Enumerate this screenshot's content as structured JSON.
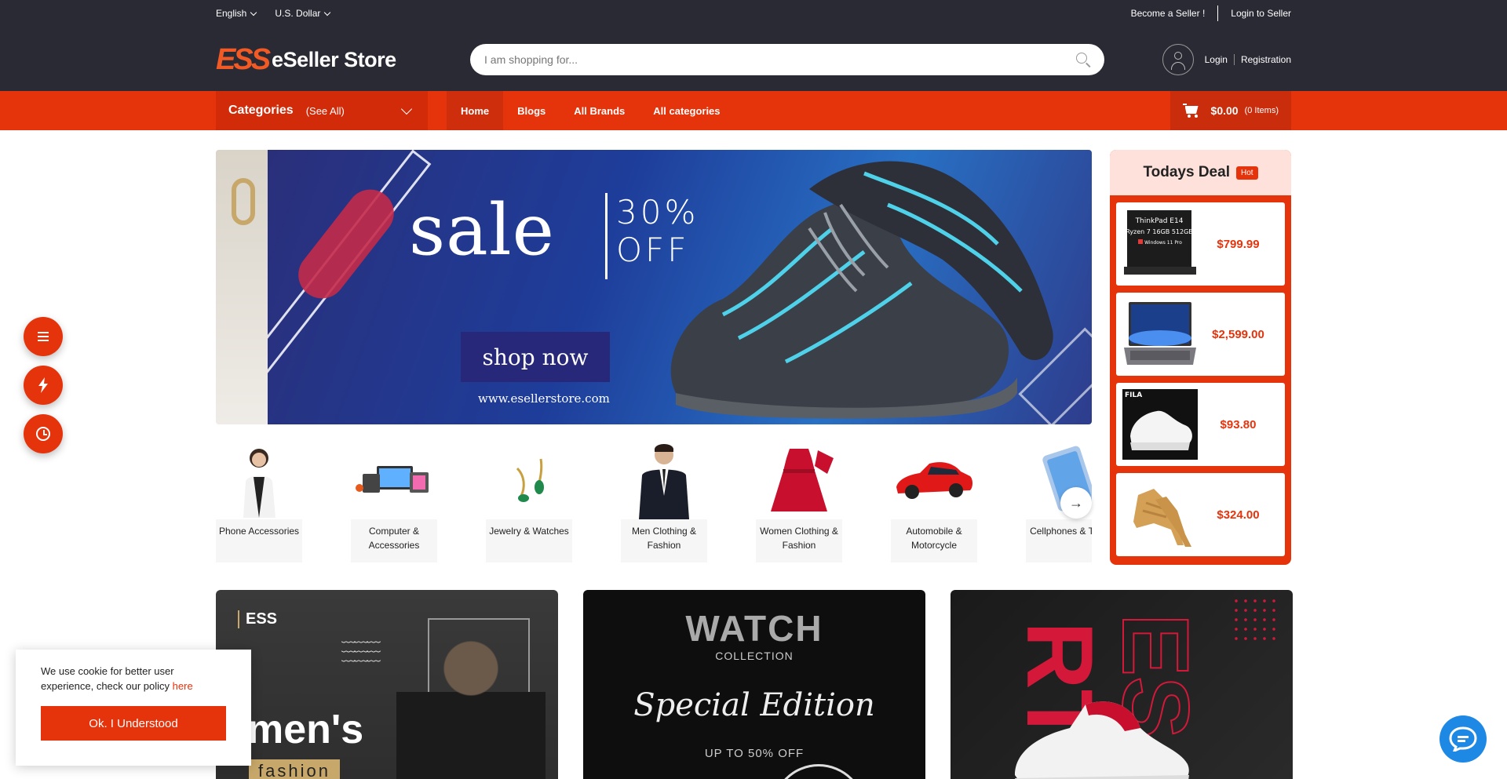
{
  "topbar": {
    "language": "English",
    "currency": "U.S. Dollar",
    "become_seller": "Become a Seller !",
    "login_seller": "Login to Seller"
  },
  "header": {
    "logo_mark": "ESS",
    "logo_text": "eSeller Store",
    "search_placeholder": "I am shopping for...",
    "login": "Login",
    "registration": "Registration"
  },
  "nav": {
    "categories_label": "Categories",
    "see_all": "(See All)",
    "links": [
      "Home",
      "Blogs",
      "All Brands",
      "All categories"
    ],
    "cart_amount": "$0.00",
    "cart_items": "(0 Items)"
  },
  "hero": {
    "sale": "sale",
    "percent_line1": "30%",
    "percent_line2": "OFF",
    "button": "shop now",
    "url": "www.esellerstore.com"
  },
  "categories": [
    {
      "label": "Phone Accessories",
      "icon": "woman-phone-image"
    },
    {
      "label": "Computer & Accessories",
      "icon": "devices-image"
    },
    {
      "label": "Jewelry & Watches",
      "icon": "earrings-image"
    },
    {
      "label": "Men Clothing & Fashion",
      "icon": "suit-man-image"
    },
    {
      "label": "Women Clothing & Fashion",
      "icon": "red-dress-image"
    },
    {
      "label": "Automobile & Motorcycle",
      "icon": "red-car-image"
    },
    {
      "label": "Cellphones & Tabs",
      "icon": "tablet-image"
    }
  ],
  "todays_deal": {
    "title": "Todays Deal",
    "badge": "Hot",
    "items": [
      {
        "price": "$799.99",
        "img_text": [
          "ThinkPad E14",
          "Ryzen 7 16GB 512GB",
          "Windows 11 Pro"
        ]
      },
      {
        "price": "$2,599.00"
      },
      {
        "price": "$93.80",
        "img_text": [
          "FILA"
        ]
      },
      {
        "price": "$324.00"
      }
    ]
  },
  "promos": {
    "p1": {
      "logo": "ESS",
      "title": "men's",
      "subtitle": "fashion"
    },
    "p2": {
      "title": "WATCH",
      "collection": "COLLECTION",
      "special": "Special Edition",
      "offer": "UP TO 50% OFF"
    },
    "p3": {
      "word1": "RT",
      "word2": "ES"
    }
  },
  "cookie": {
    "text": "We use cookie for better user experience, check our policy",
    "link": "here",
    "button": "Ok. I Understood"
  },
  "colors": {
    "brand_orange": "#e5330c",
    "topbar_dark": "#2a2a35",
    "chat_blue": "#1e88e5"
  }
}
